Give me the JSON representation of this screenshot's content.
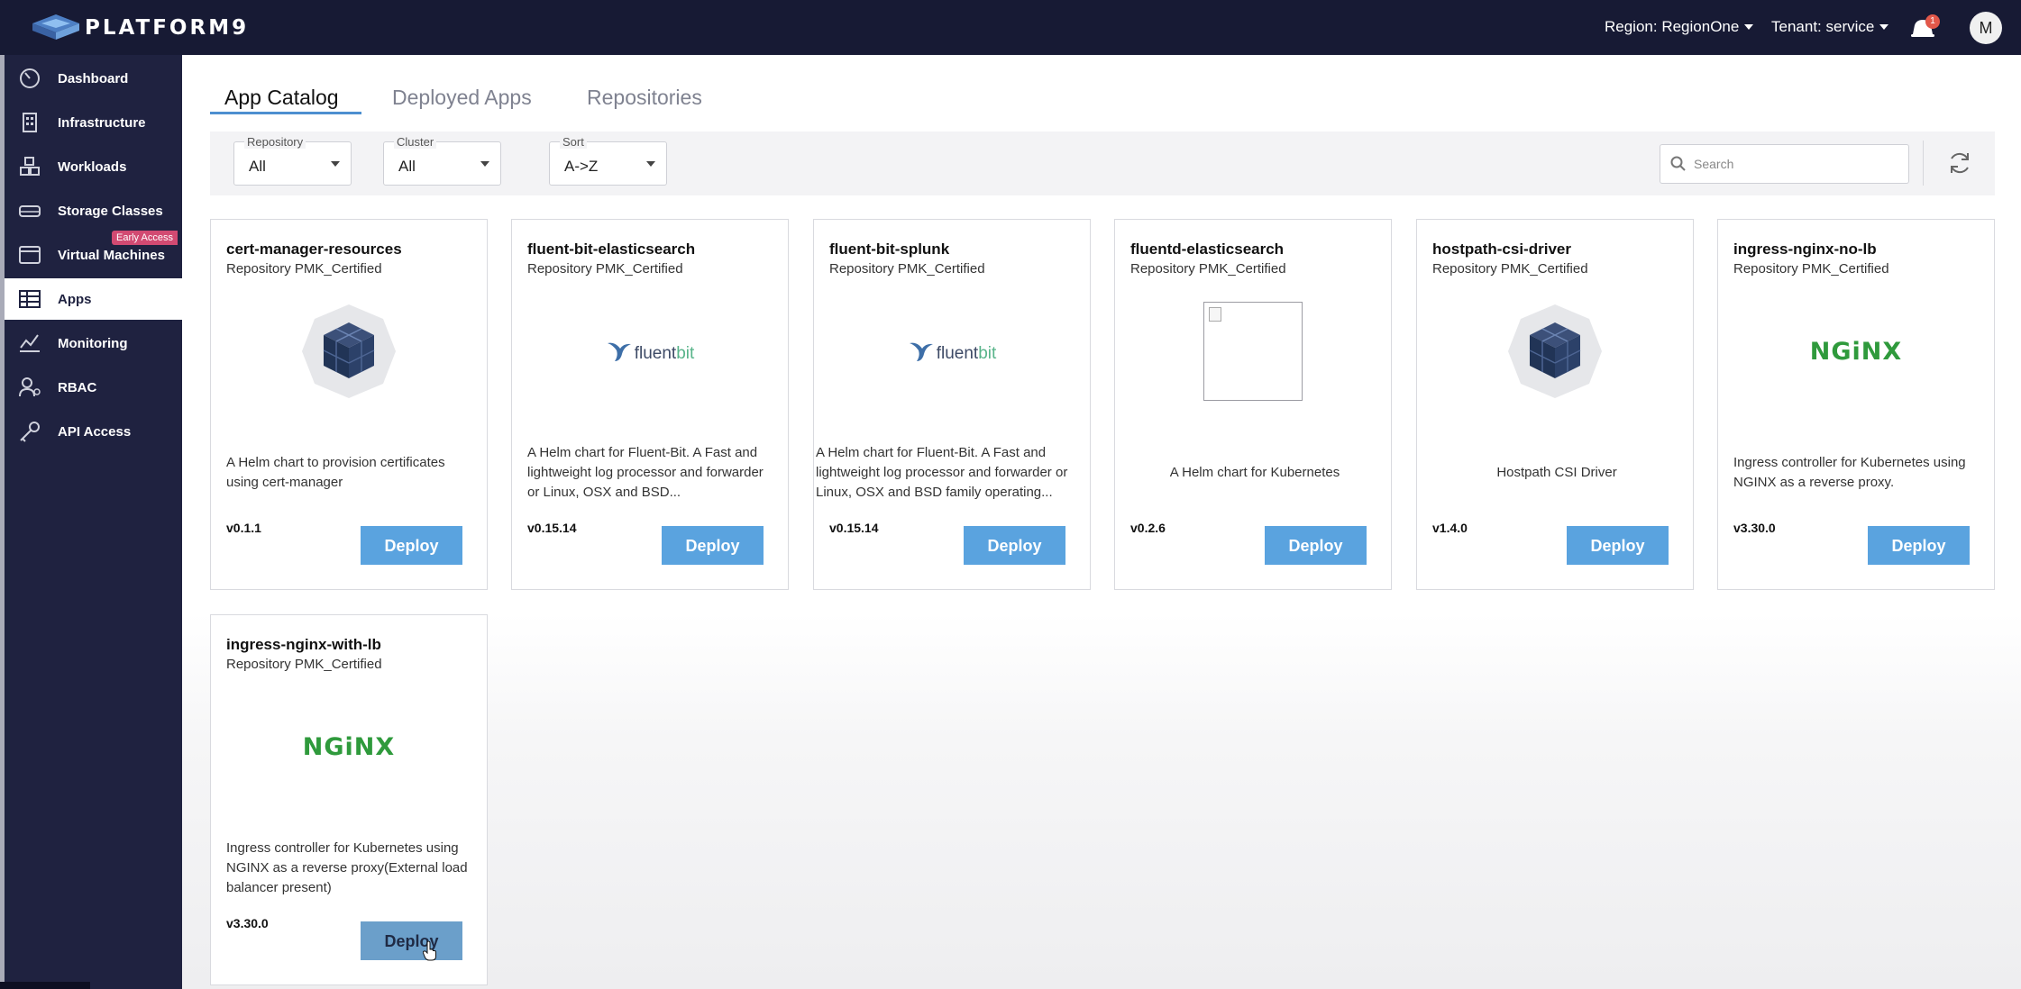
{
  "topbar": {
    "brand": "PLATFORM9",
    "region": "Region: RegionOne",
    "tenant": "Tenant: service",
    "notification_count": "1",
    "avatar_initial": "M"
  },
  "sidebar": {
    "items": [
      {
        "label": "Dashboard",
        "icon": "dashboard-gauge-icon"
      },
      {
        "label": "Infrastructure",
        "icon": "building-icon"
      },
      {
        "label": "Workloads",
        "icon": "cubes-icon"
      },
      {
        "label": "Storage Classes",
        "icon": "hard-drive-icon"
      },
      {
        "label": "Virtual Machines",
        "icon": "window-icon",
        "badge": "Early Access"
      },
      {
        "label": "Apps",
        "icon": "grid-table-icon",
        "active": true
      },
      {
        "label": "Monitoring",
        "icon": "chart-icon"
      },
      {
        "label": "RBAC",
        "icon": "user-key-icon"
      },
      {
        "label": "API Access",
        "icon": "key-icon"
      }
    ]
  },
  "tabs": [
    {
      "label": "App Catalog",
      "active": true
    },
    {
      "label": "Deployed Apps"
    },
    {
      "label": "Repositories"
    }
  ],
  "filters": {
    "repository": {
      "label": "Repository",
      "value": "All"
    },
    "cluster": {
      "label": "Cluster",
      "value": "All"
    },
    "sort": {
      "label": "Sort",
      "value": "A->Z"
    },
    "search_placeholder": "Search"
  },
  "cards": [
    {
      "title": "cert-manager-resources",
      "repo": "Repository PMK_Certified",
      "logo": "helm-cube",
      "desc": "A Helm chart to provision certificates using cert-manager",
      "version": "v0.1.1",
      "action": "Deploy"
    },
    {
      "title": "fluent-bit-elasticsearch",
      "repo": "Repository PMK_Certified",
      "logo": "fluentbit",
      "desc": "A Helm chart for Fluent-Bit. A Fast and lightweight log processor and forwarder or Linux, OSX and BSD...",
      "version": "v0.15.14",
      "action": "Deploy"
    },
    {
      "title": "fluent-bit-splunk",
      "repo": "Repository PMK_Certified",
      "logo": "fluentbit",
      "desc": "A Helm chart for Fluent-Bit. A Fast and lightweight log processor and forwarder or Linux, OSX and BSD family operating...",
      "version": "v0.15.14",
      "action": "Deploy"
    },
    {
      "title": "fluentd-elasticsearch",
      "repo": "Repository PMK_Certified",
      "logo": "broken-image",
      "desc": "A Helm chart for Kubernetes",
      "version": "v0.2.6",
      "action": "Deploy"
    },
    {
      "title": "hostpath-csi-driver",
      "repo": "Repository PMK_Certified",
      "logo": "helm-cube",
      "desc": "Hostpath CSI Driver",
      "version": "v1.4.0",
      "action": "Deploy"
    },
    {
      "title": "ingress-nginx-no-lb",
      "repo": "Repository PMK_Certified",
      "logo": "nginx",
      "desc": "Ingress controller for Kubernetes using NGINX as a reverse proxy.",
      "version": "v3.30.0",
      "action": "Deploy"
    },
    {
      "title": "ingress-nginx-with-lb",
      "repo": "Repository PMK_Certified",
      "logo": "nginx",
      "desc": "Ingress controller for Kubernetes using NGINX as a reverse proxy(External load balancer present)",
      "version": "v3.30.0",
      "action": "Deploy"
    }
  ],
  "logo_text": {
    "fluent": "fluent",
    "bit": "bit",
    "nginx": "NGiNX"
  },
  "colors": {
    "topbar": "#171a34",
    "sidebar": "#1f2240",
    "accent": "#5aa3df",
    "badge": "#d24a72",
    "nginx_green": "#2f9a3c"
  }
}
